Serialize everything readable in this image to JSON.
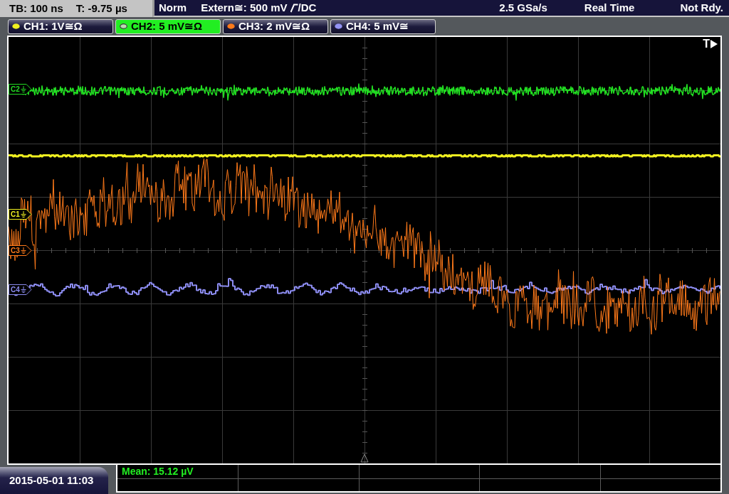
{
  "status_bar": {
    "timebase": "TB: 100 ns",
    "trigger_time": "T: -9.75 µs",
    "mode": "Norm",
    "trigger_source": "Extern≅: 500 mV",
    "trigger_coupling": "/DC",
    "sample_rate": "2.5 GSa/s",
    "acquisition": "Real Time",
    "state": "Not Rdy."
  },
  "channels": [
    {
      "label": "CH1: 1V≅Ω",
      "color": "#f0f020",
      "selected": false
    },
    {
      "label": "CH2: 5 mV≅Ω",
      "color": "#b8dcb0",
      "selected": true
    },
    {
      "label": "CH3: 2 mV≅Ω",
      "color": "#ff7a1a",
      "selected": false
    },
    {
      "label": "CH4: 5 mV≅",
      "color": "#9494f4",
      "selected": false
    }
  ],
  "display": {
    "trigger_marker": "T",
    "channel_markers": [
      {
        "label": "C2",
        "color": "#22dd22"
      },
      {
        "label": "C1",
        "color": "#f0f020"
      },
      {
        "label": "C3",
        "color": "#ff7a1a"
      },
      {
        "label": "C4",
        "color": "#8c8cf0"
      }
    ]
  },
  "measurements": {
    "cells": [
      "Mean: 15.12 µV"
    ]
  },
  "timestamp": "2015-05-01 11:03"
}
